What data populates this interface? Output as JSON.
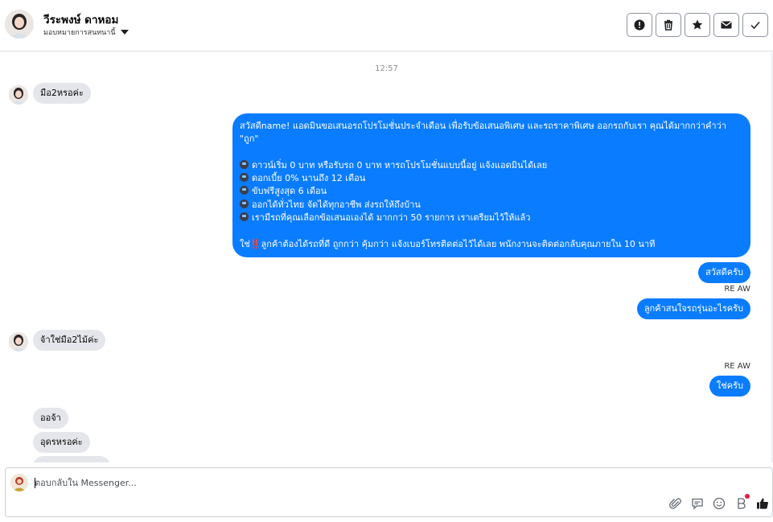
{
  "header": {
    "contact_name": "วีระพงษ์ ดาหอม",
    "assign_label": "มอบหมายการสนทนานี้",
    "actions": [
      {
        "name": "mark-spam-button",
        "icon": "exclamation-circle-icon"
      },
      {
        "name": "delete-button",
        "icon": "trash-icon"
      },
      {
        "name": "star-button",
        "icon": "star-icon"
      },
      {
        "name": "mark-unread-button",
        "icon": "envelope-icon"
      },
      {
        "name": "mark-done-button",
        "icon": "checkmark-icon"
      }
    ]
  },
  "conversation": {
    "timestamp": "12:57",
    "messages": [
      {
        "from": "customer",
        "text": "มือ2หรอค่ะ"
      },
      {
        "from": "page",
        "lines": [
          "สวัสดีname! แอดมินขอเสนอรถโปรโมชั่นประจำเดือน เพื่อรับข้อเสนอพิเศษ และรถราคาพิเศษ ออกรถกับเรา คุณได้มากกว่าคำว่า",
          "\"ถูก\"",
          "",
          "ดาวน์เริ่ม 0 บาท หรือรับรถ 0 บาท หารถโปรโมชั่นแบบนี้อยู่ แจ้งแอดมินได้เลย",
          "ดอกเบี้ย 0% นานถึง 12 เดือน",
          "ขับฟรีสูงสุด 6 เดือน",
          "ออกได้ทั่วไทย จัดได้ทุกอาชีพ ส่งรถให้ถึงบ้าน",
          "เรามีรถที่คุณเลือกข้อเสนอเองได้ มากกว่า 50 รายการ เราเตรียมไว้ให้แล้ว",
          "",
          "ใช่",
          "‼️",
          "ลูกค้าต้องได้รถที่ดี ถูกกว่า คุ้มกว่า แจ้งเบอร์โทรติดต่อไว้ได้เลย พนักงานจะติดต่อกลับคุณภายใน 10 นาที"
        ]
      },
      {
        "from": "page",
        "text": "สวัสดีครับ"
      },
      {
        "from": "page",
        "sender": "RE AW",
        "text": "ลูกค้าสนใจรถรุ่นอะไรครับ"
      },
      {
        "from": "customer",
        "text": "จ้าใช่มือ2ไม้ค่ะ"
      },
      {
        "from": "page",
        "sender": "RE AW",
        "text": "ใช่ครับ"
      },
      {
        "from": "customer",
        "text": "ออจ้า"
      },
      {
        "from": "customer",
        "text": "อุดรหรอค่ะ"
      }
    ]
  },
  "composer": {
    "placeholder": "ตอบกลับใน Messenger...",
    "value": "",
    "tools": [
      "paperclip-icon",
      "saved-replies-icon",
      "emoji-icon",
      "bot-icon",
      "like-icon"
    ]
  },
  "colors": {
    "outgoing_bubble": "#0a7cff",
    "incoming_bubble": "#e4e6eb",
    "notification_dot": "#e41e3f"
  }
}
